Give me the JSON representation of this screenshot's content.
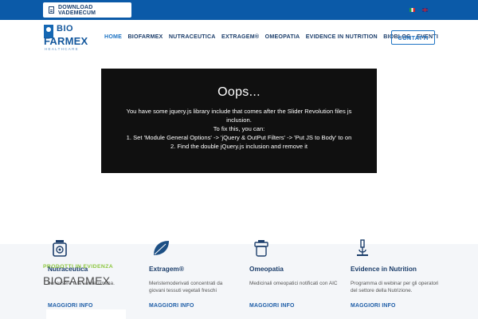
{
  "topbar": {
    "download_label": "DOWNLOAD VADEMECUM"
  },
  "brand": {
    "line1": "BIO",
    "line2": "FARMEX",
    "line3": "HEALTHCARE"
  },
  "nav": {
    "items": [
      {
        "label": "HOME",
        "active": true
      },
      {
        "label": "BIOFARMEX",
        "active": false
      },
      {
        "label": "NUTRACEUTICA",
        "active": false
      },
      {
        "label": "EXTRAGEM®",
        "active": false
      },
      {
        "label": "OMEOPATIA",
        "active": false
      },
      {
        "label": "EVIDENCE IN NUTRITION",
        "active": false
      },
      {
        "label": "BIOBLOG",
        "active": false
      },
      {
        "label": "EVENTI",
        "active": false
      }
    ],
    "contact_label": "CONTATTI"
  },
  "error_box": {
    "title": "Oops...",
    "message": "You have some jquery.js library include that comes after the Slider Revolution files js inclusion.",
    "fix_intro": "To fix this, you can:",
    "step1": "1. Set 'Module General Options' -> 'jQuery & OutPut Filters' -> 'Put JS to Body' to on",
    "step2": "2. Find the double jQuery.js inclusion and remove it"
  },
  "overlay": {
    "kicker": "PRODOTTI IN EVIDENZA",
    "title": "BIOFARMEX"
  },
  "features": [
    {
      "title": "Nutraceutica",
      "text": "benessere e la salute umana.",
      "more": "MAGGIORI INFO",
      "icon": "supplement-bottle-icon"
    },
    {
      "title": "Extragem®",
      "text": "Meristemoderivati concentrati da giovani tessuti vegetali freschi",
      "more": "MAGGIORI INFO",
      "icon": "leaf-icon"
    },
    {
      "title": "Omeopatia",
      "text": "Medicinali omeopatici notificati con AIC",
      "more": "MAGGIORI INFO",
      "icon": "homeopathy-vial-icon"
    },
    {
      "title": "Evidence in Nutrition",
      "text": "Programma di webinar per gli operatori del settore della Nutrizione.",
      "more": "MAGGIORI INFO",
      "icon": "microscope-icon"
    }
  ],
  "colors": {
    "topbar": "#0b5aa8",
    "brand_blue": "#14589d",
    "nav_text": "#1c3e6b",
    "accent_green": "#8cc63e"
  }
}
